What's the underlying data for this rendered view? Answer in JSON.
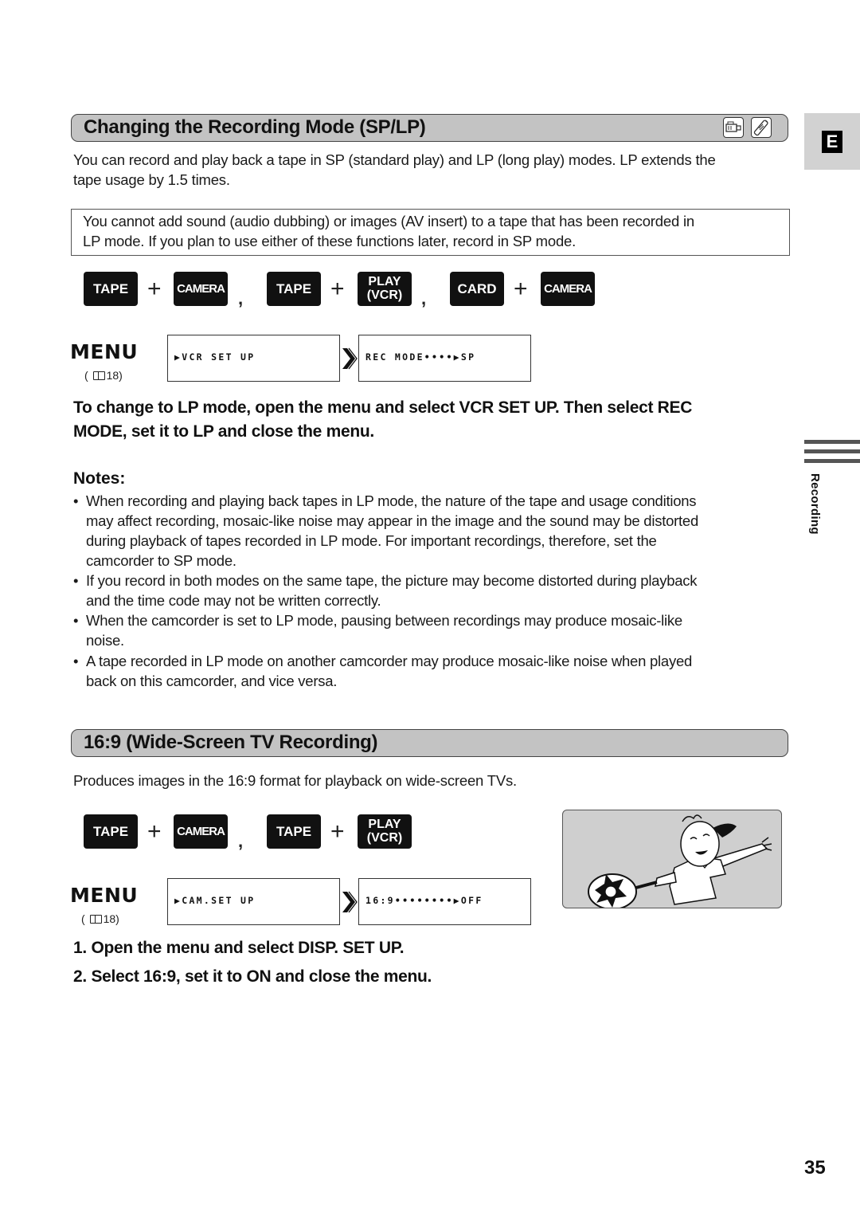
{
  "side_tab": {
    "letter": "E",
    "chapter_label": "Recording"
  },
  "section1": {
    "title": "Changing the Recording Mode (SP/LP)",
    "mode_icons": [
      "camcorder-icon",
      "remote-control-icon"
    ],
    "intro": [
      "You can record and play back a tape in SP (standard play) and LP (long play) modes. LP extends the",
      "tape usage by 1.5 times."
    ],
    "caution": [
      "You cannot add sound (audio dubbing) or images (AV insert) to a tape that has been recorded in",
      "LP mode. If you plan to use either of these functions later, record in SP mode."
    ],
    "mode_combos": [
      {
        "a": "TAPE",
        "b": "CAMERA"
      },
      {
        "a": "TAPE",
        "b_line1": "PLAY",
        "b_line2": "(VCR)"
      },
      {
        "a": "CARD",
        "b": "CAMERA"
      }
    ],
    "plus": "+",
    "comma": ",",
    "menu_label": "MENU",
    "page_ref": {
      "open": "(",
      "page": "18)"
    },
    "menu_step1": "▶VCR SET UP",
    "menu_step2": "REC MODE••••▶SP",
    "instruction": [
      "To change to LP mode, open the menu and select VCR SET UP. Then select REC",
      "MODE, set it to LP and close the menu."
    ],
    "notes_heading": "Notes:",
    "notes": [
      {
        "bullet": "•",
        "lines": [
          "When recording and playing back tapes in LP mode, the nature of the tape and usage conditions",
          "may affect recording, mosaic-like noise may appear in the image and the sound may be distorted",
          "during playback of tapes recorded in LP mode. For important recordings, therefore, set the",
          "camcorder to SP mode."
        ]
      },
      {
        "bullet": "•",
        "lines": [
          "If you record in both modes on the same tape, the picture may become distorted during playback",
          "and the time code may not be written correctly."
        ]
      },
      {
        "bullet": "•",
        "lines": [
          "When the camcorder is set to LP mode, pausing between recordings may produce mosaic-like",
          "noise."
        ]
      },
      {
        "bullet": "•",
        "lines": [
          "A tape recorded in LP mode on another camcorder may produce mosaic-like noise when played",
          "back on this camcorder, and vice versa."
        ]
      }
    ]
  },
  "section2": {
    "title": "16:9 (Wide-Screen TV Recording)",
    "intro": "Produces images in the 16:9 format for playback on wide-screen TVs.",
    "mode_combos": [
      {
        "a": "TAPE",
        "b": "CAMERA"
      },
      {
        "a": "TAPE",
        "b_line1": "PLAY",
        "b_line2": "(VCR)"
      }
    ],
    "menu_label": "MENU",
    "page_ref": {
      "open": "(",
      "page": "18)"
    },
    "menu_step1": "▶CAM.SET UP",
    "menu_step2": "16:9••••••••▶OFF",
    "illustration": "tennis-player-widescreen-illustration",
    "steps": [
      "1.  Open the menu and select DISP. SET UP.",
      "2.  Select 16:9, set it to ON and close the menu."
    ]
  },
  "page_number": "35"
}
